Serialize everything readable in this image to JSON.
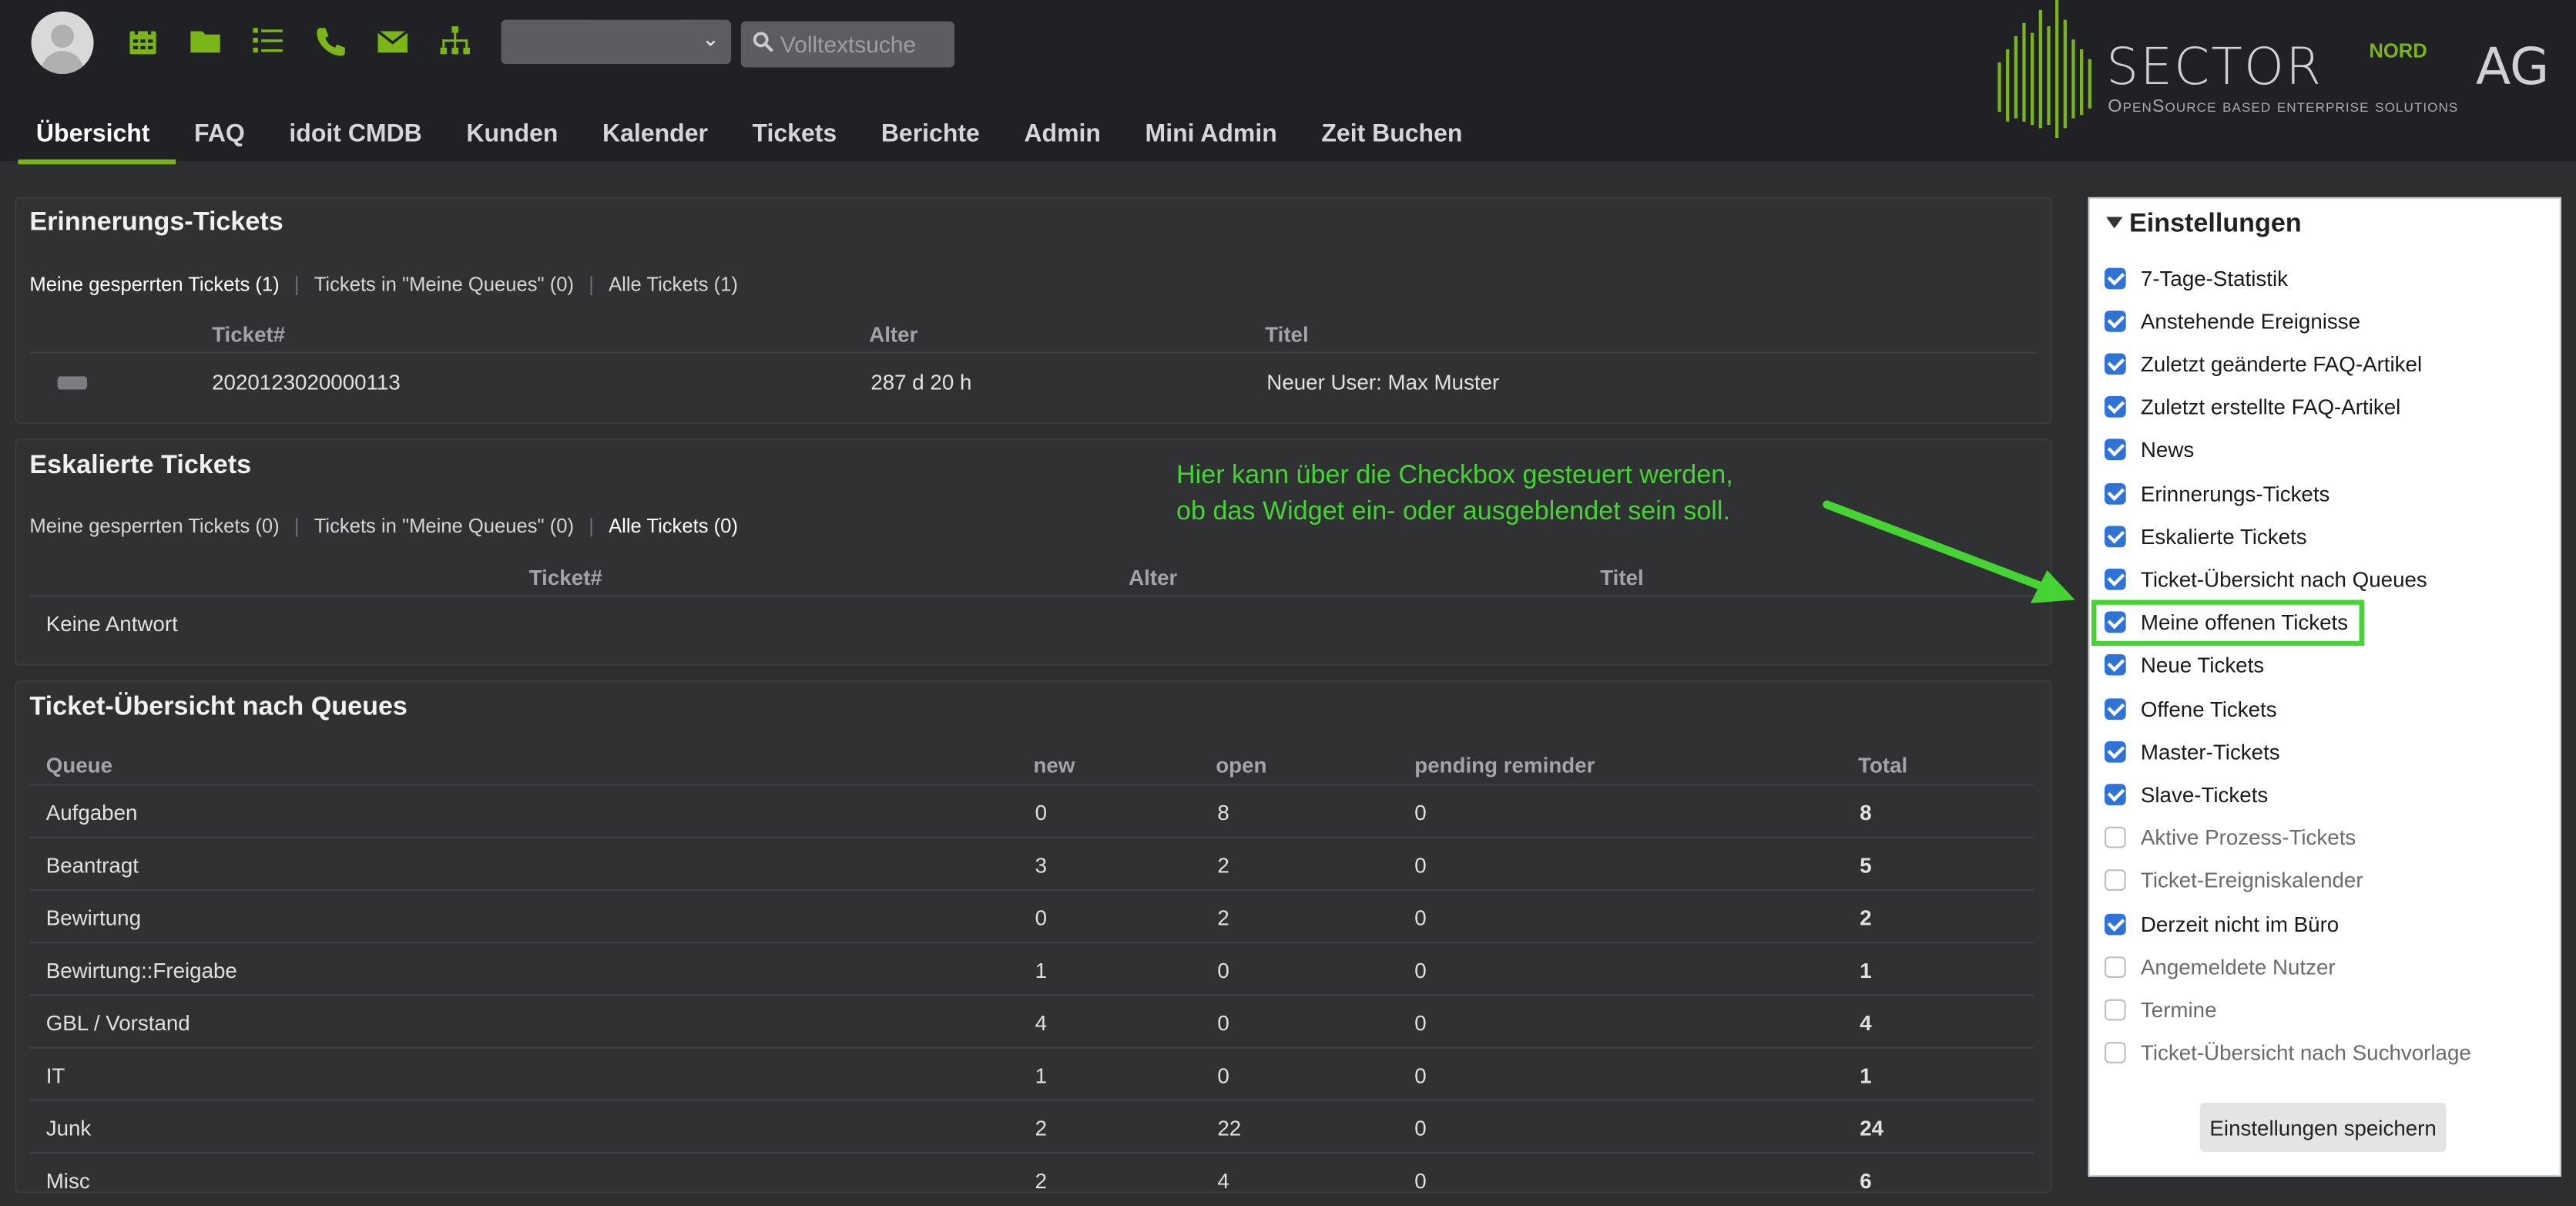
{
  "header": {
    "search_placeholder": "Volltextsuche",
    "icons": [
      "calendar-icon",
      "folder-icon",
      "list-icon",
      "phone-icon",
      "envelope-icon",
      "sitemap-icon"
    ]
  },
  "logo": {
    "word": "SECTOR",
    "sup": "NORD",
    "ag": "AG",
    "tagline": "OpenSource based enterprise solutions"
  },
  "nav": {
    "tabs": [
      "Übersicht",
      "FAQ",
      "idoit CMDB",
      "Kunden",
      "Kalender",
      "Tickets",
      "Berichte",
      "Admin",
      "Mini Admin",
      "Zeit Buchen"
    ],
    "active": "Übersicht"
  },
  "erinnerung": {
    "title": "Erinnerungs-Tickets",
    "tabs": [
      "Meine gesperrten Tickets (1)",
      "Tickets in \"Meine Queues\" (0)",
      "Alle Tickets (1)"
    ],
    "headers": {
      "ticket": "Ticket#",
      "alter": "Alter",
      "titel": "Titel"
    },
    "row": {
      "ticket": "2020123020000113",
      "alter": "287 d 20 h",
      "titel": "Neuer User: Max Muster"
    }
  },
  "eskaliert": {
    "title": "Eskalierte Tickets",
    "tabs": [
      "Meine gesperrten Tickets (0)",
      "Tickets in \"Meine Queues\" (0)",
      "Alle Tickets (0)"
    ],
    "headers": {
      "ticket": "Ticket#",
      "alter": "Alter",
      "titel": "Titel"
    },
    "empty": "Keine Antwort"
  },
  "queues": {
    "title": "Ticket-Übersicht nach Queues",
    "headers": {
      "queue": "Queue",
      "new": "new",
      "open": "open",
      "pending": "pending reminder",
      "total": "Total"
    },
    "rows": [
      {
        "queue": "Aufgaben",
        "new": "0",
        "open": "8",
        "pending": "0",
        "total": "8"
      },
      {
        "queue": "Beantragt",
        "new": "3",
        "open": "2",
        "pending": "0",
        "total": "5"
      },
      {
        "queue": "Bewirtung",
        "new": "0",
        "open": "2",
        "pending": "0",
        "total": "2"
      },
      {
        "queue": "Bewirtung::Freigabe",
        "new": "1",
        "open": "0",
        "pending": "0",
        "total": "1"
      },
      {
        "queue": "GBL / Vorstand",
        "new": "4",
        "open": "0",
        "pending": "0",
        "total": "4"
      },
      {
        "queue": "IT",
        "new": "1",
        "open": "0",
        "pending": "0",
        "total": "1"
      },
      {
        "queue": "Junk",
        "new": "2",
        "open": "22",
        "pending": "0",
        "total": "24"
      },
      {
        "queue": "Misc",
        "new": "2",
        "open": "4",
        "pending": "0",
        "total": "6"
      }
    ]
  },
  "settings": {
    "title": "Einstellungen",
    "options": [
      {
        "label": "7-Tage-Statistik",
        "checked": true
      },
      {
        "label": "Anstehende Ereignisse",
        "checked": true
      },
      {
        "label": "Zuletzt geänderte FAQ-Artikel",
        "checked": true
      },
      {
        "label": "Zuletzt erstellte FAQ-Artikel",
        "checked": true
      },
      {
        "label": "News",
        "checked": true
      },
      {
        "label": "Erinnerungs-Tickets",
        "checked": true
      },
      {
        "label": "Eskalierte Tickets",
        "checked": true
      },
      {
        "label": "Ticket-Übersicht nach Queues",
        "checked": true
      },
      {
        "label": "Meine offenen Tickets",
        "checked": true
      },
      {
        "label": "Neue Tickets",
        "checked": true
      },
      {
        "label": "Offene Tickets",
        "checked": true
      },
      {
        "label": "Master-Tickets",
        "checked": true
      },
      {
        "label": "Slave-Tickets",
        "checked": true
      },
      {
        "label": "Aktive Prozess-Tickets",
        "checked": false
      },
      {
        "label": "Ticket-Ereigniskalender",
        "checked": false
      },
      {
        "label": "Derzeit nicht im Büro",
        "checked": true
      },
      {
        "label": "Angemeldete Nutzer",
        "checked": false
      },
      {
        "label": "Termine",
        "checked": false
      },
      {
        "label": "Ticket-Übersicht nach Suchvorlage",
        "checked": false
      }
    ],
    "save_label": "Einstellungen speichern"
  },
  "annotation": {
    "line1": "Hier kann über die Checkbox gesteuert werden,",
    "line2": "ob das Widget ein- oder ausgeblendet sein soll.",
    "color": "#46d334"
  },
  "colors": {
    "accent": "#7cb518",
    "topbar": "#202124",
    "background": "#2d2e2f"
  }
}
